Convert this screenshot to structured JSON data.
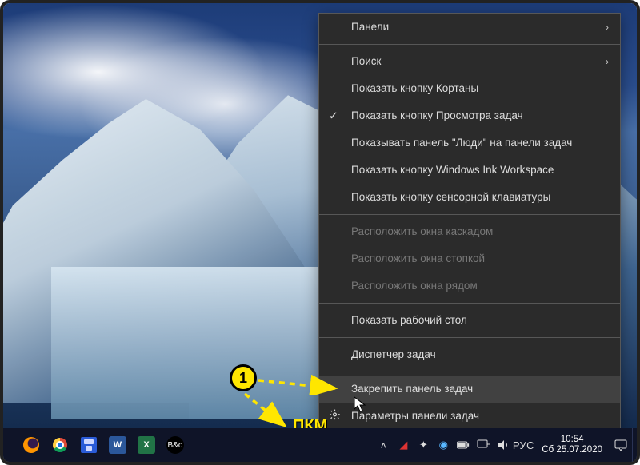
{
  "annotation": {
    "badge": "1",
    "label": "ПКМ"
  },
  "context_menu": {
    "items": [
      {
        "label": "Панели",
        "submenu": true
      },
      {
        "sep": true
      },
      {
        "label": "Поиск",
        "submenu": true
      },
      {
        "label": "Показать кнопку Кортаны"
      },
      {
        "label": "Показать кнопку Просмотра задач",
        "checked": true
      },
      {
        "label": "Показывать панель \"Люди\" на панели задач"
      },
      {
        "label": "Показать кнопку Windows Ink Workspace"
      },
      {
        "label": "Показать кнопку сенсорной клавиатуры"
      },
      {
        "sep": true
      },
      {
        "label": "Расположить окна каскадом",
        "disabled": true
      },
      {
        "label": "Расположить окна стопкой",
        "disabled": true
      },
      {
        "label": "Расположить окна рядом",
        "disabled": true
      },
      {
        "sep": true
      },
      {
        "label": "Показать рабочий стол"
      },
      {
        "sep": true
      },
      {
        "label": "Диспетчер задач"
      },
      {
        "sep": true
      },
      {
        "label": "Закрепить панель задач",
        "hover": true
      },
      {
        "label": "Параметры панели задач",
        "gear": true
      }
    ]
  },
  "taskbar": {
    "apps": [
      {
        "name": "firefox",
        "title": "Firefox"
      },
      {
        "name": "chrome",
        "title": "Chrome"
      },
      {
        "name": "save",
        "title": "Save"
      },
      {
        "name": "word",
        "title": "W"
      },
      {
        "name": "excel",
        "title": "X"
      },
      {
        "name": "bo",
        "title": "B&o"
      }
    ],
    "tray": {
      "chevron": "˄",
      "icons": [
        "security-icon",
        "app-icon",
        "eye-icon",
        "battery-icon",
        "network-icon",
        "volume-icon"
      ],
      "lang": "РУС",
      "time": "10:54",
      "date": "Сб 25.07.2020"
    }
  }
}
